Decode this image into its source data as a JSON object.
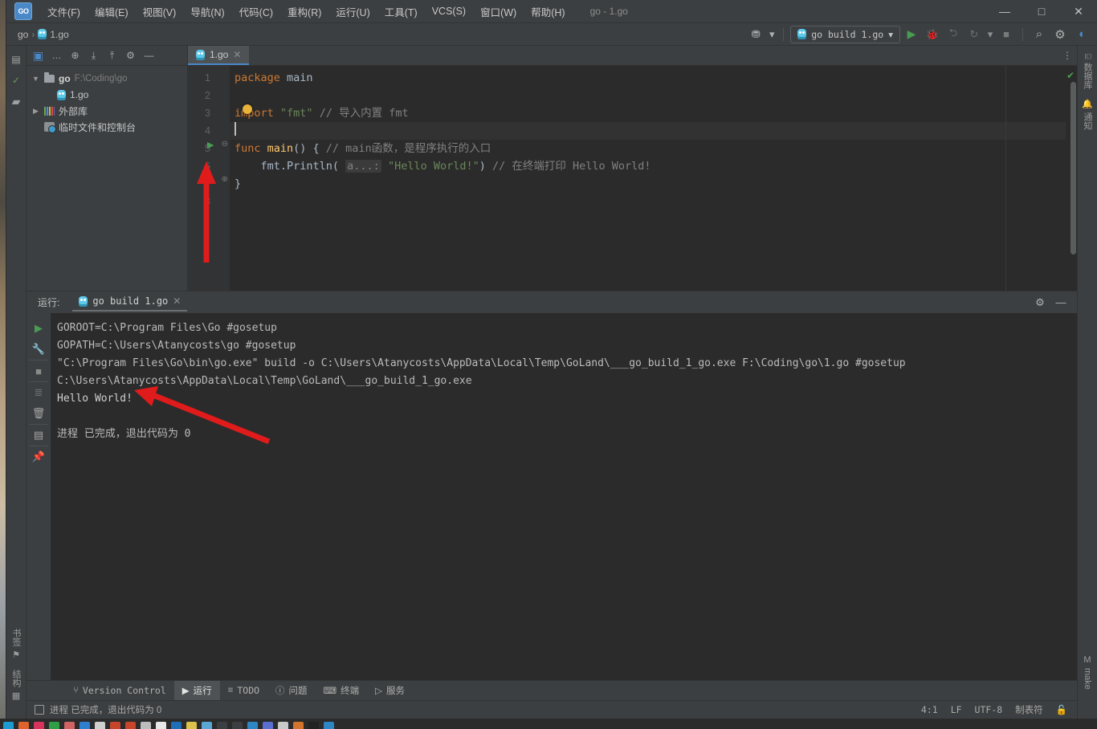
{
  "window": {
    "title": "go - 1.go",
    "logo_text": "GO",
    "minimize": "—",
    "maximize": "□",
    "close": "✕"
  },
  "menubar": [
    {
      "label": "文件(F)",
      "name": "menu-file"
    },
    {
      "label": "编辑(E)",
      "name": "menu-edit"
    },
    {
      "label": "视图(V)",
      "name": "menu-view"
    },
    {
      "label": "导航(N)",
      "name": "menu-navigate"
    },
    {
      "label": "代码(C)",
      "name": "menu-code"
    },
    {
      "label": "重构(R)",
      "name": "menu-refactor"
    },
    {
      "label": "运行(U)",
      "name": "menu-run"
    },
    {
      "label": "工具(T)",
      "name": "menu-tools"
    },
    {
      "label": "VCS(S)",
      "name": "menu-vcs"
    },
    {
      "label": "窗口(W)",
      "name": "menu-window"
    },
    {
      "label": "帮助(H)",
      "name": "menu-help"
    }
  ],
  "navbar": {
    "breadcrumbs": [
      "go",
      "1.go"
    ],
    "separator": "›",
    "run_config": "go build 1.go",
    "run_config_caret": "▾",
    "icons": {
      "account": "⛃",
      "account_caret": "▾",
      "run": "▶",
      "debug": "🐞",
      "run_coverage": "⮌",
      "profile": "↻",
      "profile_caret": "▾",
      "stop": "■",
      "search": "⌕",
      "settings": "⚙",
      "updates": "◖"
    }
  },
  "project": {
    "header_icons": [
      "project-view-selector",
      "more-options",
      "locate-file",
      "expand-all",
      "collapse-all",
      "settings",
      "hide"
    ],
    "header_glyphs": {
      "selector": "▣",
      "more": "…",
      "locate": "⊕",
      "expand": "⤓",
      "collapse": "⤒",
      "settings": "⚙",
      "hide": "—"
    },
    "tree": [
      {
        "name": "go",
        "path": "F:\\Coding\\go",
        "twisty": "▼",
        "icon": "folder",
        "depth": 0,
        "bold": true
      },
      {
        "name": "1.go",
        "path": "",
        "twisty": "",
        "icon": "gopher",
        "depth": 1,
        "bold": false
      },
      {
        "name": "外部库",
        "path": "",
        "twisty": "▶",
        "icon": "library",
        "depth": 0,
        "bold": false
      },
      {
        "name": "临时文件和控制台",
        "path": "",
        "twisty": "",
        "icon": "scratch",
        "depth": 0,
        "bold": false
      }
    ]
  },
  "editor": {
    "tab": {
      "label": "1.go",
      "close": "✕"
    },
    "tab_more": "⋮",
    "inspection_ok": "✔",
    "lines": [
      {
        "n": "1",
        "tokens": [
          {
            "t": "package ",
            "c": "kw"
          },
          {
            "t": "main",
            "c": "pl"
          }
        ],
        "runmark": false,
        "fold": "",
        "current": false
      },
      {
        "n": "2",
        "tokens": [],
        "runmark": false,
        "fold": "",
        "current": false
      },
      {
        "n": "3",
        "tokens": [
          {
            "t": "import ",
            "c": "kw"
          },
          {
            "t": "\"fmt\" ",
            "c": "str"
          },
          {
            "t": "// 导入内置 fmt",
            "c": "cm"
          }
        ],
        "runmark": false,
        "fold": "",
        "current": false
      },
      {
        "n": "4",
        "tokens": [],
        "runmark": false,
        "fold": "",
        "current": true
      },
      {
        "n": "5",
        "tokens": [
          {
            "t": "func ",
            "c": "kw"
          },
          {
            "t": "main",
            "c": "fn"
          },
          {
            "t": "() { ",
            "c": "pl"
          },
          {
            "t": "// main函数，是程序执行的入口",
            "c": "cm"
          }
        ],
        "runmark": true,
        "fold": "⊖",
        "current": false
      },
      {
        "n": "6",
        "tokens": [
          {
            "t": "    fmt.Println( ",
            "c": "pl"
          },
          {
            "t": "a...:",
            "c": "hint"
          },
          {
            "t": " ",
            "c": "pl"
          },
          {
            "t": "\"Hello World!\"",
            "c": "str"
          },
          {
            "t": ") ",
            "c": "pl"
          },
          {
            "t": "// 在终端打印 Hello World!",
            "c": "cm"
          }
        ],
        "runmark": false,
        "fold": "",
        "current": false
      },
      {
        "n": "7",
        "tokens": [
          {
            "t": "}",
            "c": "pl"
          }
        ],
        "runmark": false,
        "fold": "⊕",
        "current": false
      },
      {
        "n": "8",
        "tokens": [],
        "runmark": false,
        "fold": "",
        "current": false
      }
    ]
  },
  "run_panel": {
    "title": "运行:",
    "tab_label": "go build 1.go",
    "tab_close": "✕",
    "settings_icon": "⚙",
    "hide_icon": "—",
    "tools": [
      {
        "name": "rerun-button",
        "glyph": "▶"
      },
      {
        "name": "edit-configurations-button",
        "glyph": "🔧"
      },
      {
        "name": "stop-button",
        "glyph": "■"
      },
      {
        "name": "filter-button",
        "glyph": "≣"
      },
      {
        "name": "clear-all-button",
        "glyph": "🗑"
      },
      {
        "name": "layout-button",
        "glyph": "▤"
      },
      {
        "name": "pin-tab-button",
        "glyph": "📌"
      }
    ],
    "console": [
      {
        "text": "GOROOT=C:\\Program Files\\Go #gosetup",
        "kind": "sys"
      },
      {
        "text": "GOPATH=C:\\Users\\Atanycosts\\go #gosetup",
        "kind": "sys"
      },
      {
        "text": "\"C:\\Program Files\\Go\\bin\\go.exe\" build -o C:\\Users\\Atanycosts\\AppData\\Local\\Temp\\GoLand\\___go_build_1_go.exe F:\\Coding\\go\\1.go #gosetup",
        "kind": "sys"
      },
      {
        "text": "C:\\Users\\Atanycosts\\AppData\\Local\\Temp\\GoLand\\___go_build_1_go.exe",
        "kind": "sys"
      },
      {
        "text": "Hello World!",
        "kind": "out"
      },
      {
        "text": "",
        "kind": "sys"
      },
      {
        "text": "进程 已完成，退出代码为 0",
        "kind": "sys"
      }
    ]
  },
  "left_strip": {
    "top": [
      {
        "name": "project-tool-button",
        "glyph": "▤"
      },
      {
        "name": "commit-tool-button",
        "glyph": "✓"
      },
      {
        "name": "structure-folder-icon",
        "glyph": "▰"
      }
    ],
    "bottom": [
      {
        "label": "书签",
        "glyph": "⚑",
        "name": "bookmarks-tool-button"
      },
      {
        "label": "结构",
        "glyph": "▦",
        "name": "structure-tool-button"
      }
    ]
  },
  "right_strip": {
    "top": [
      {
        "label": "数据库",
        "glyph": "⌸",
        "name": "database-tool-button"
      },
      {
        "label": "通知",
        "glyph": "🔔",
        "name": "notifications-tool-button"
      }
    ],
    "bottom": [
      {
        "label": "make",
        "glyph": "M",
        "name": "make-tool-button"
      }
    ]
  },
  "bottom_tabs": [
    {
      "label": "Version Control",
      "glyph": "⑂",
      "selected": false,
      "name": "tab-version-control"
    },
    {
      "label": "运行",
      "glyph": "▶",
      "selected": true,
      "name": "tab-run"
    },
    {
      "label": "TODO",
      "glyph": "≡",
      "selected": false,
      "name": "tab-todo"
    },
    {
      "label": "问题",
      "glyph": "ⓘ",
      "selected": false,
      "name": "tab-problems"
    },
    {
      "label": "终端",
      "glyph": "⌨",
      "selected": false,
      "name": "tab-terminal"
    },
    {
      "label": "服务",
      "glyph": "▷",
      "selected": false,
      "name": "tab-services"
    }
  ],
  "status_bar": {
    "message": "进程 已完成，退出代码为 0",
    "caret_position": "4:1",
    "line_separator": "LF",
    "encoding": "UTF-8",
    "indent": "制表符",
    "lock_icon": "🔓"
  },
  "colors": {
    "accent_blue": "#4a88c7",
    "keyword_orange": "#cc7832",
    "string_green": "#6a8759",
    "comment_gray": "#808080",
    "function_yellow": "#ffc66d",
    "run_green": "#499c54",
    "annotation_red": "#e01b1b",
    "panel_bg": "#3c3f41",
    "editor_bg": "#2b2b2b"
  }
}
